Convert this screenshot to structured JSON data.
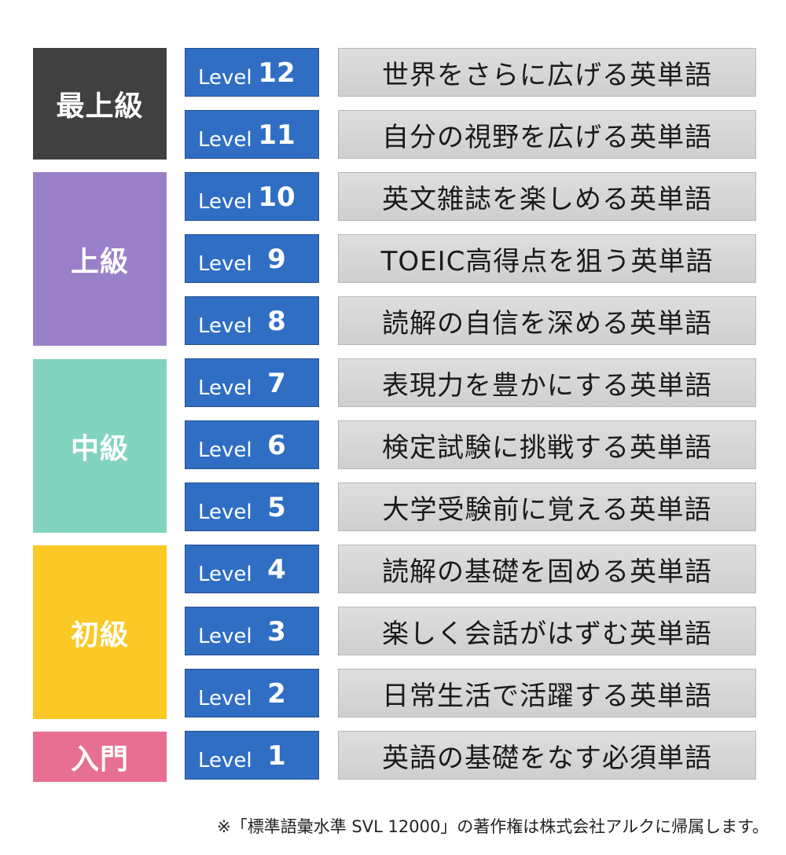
{
  "groups": [
    {
      "label": "最上級",
      "color": "#404040"
    },
    {
      "label": "上級",
      "color": "#9a80c9"
    },
    {
      "label": "中級",
      "color": "#82d4c0"
    },
    {
      "label": "初級",
      "color": "#fbc925"
    },
    {
      "label": "入門",
      "color": "#e76f92"
    }
  ],
  "levels": [
    {
      "word": "Level",
      "num": "12",
      "desc": "世界をさらに広げる英単語"
    },
    {
      "word": "Level",
      "num": "11",
      "desc": "自分の視野を広げる英単語"
    },
    {
      "word": "Level",
      "num": "10",
      "desc": "英文雑誌を楽しめる英単語"
    },
    {
      "word": "Level",
      "num": "9",
      "desc": "TOEIC高得点を狙う英単語"
    },
    {
      "word": "Level",
      "num": "8",
      "desc": "読解の自信を深める英単語"
    },
    {
      "word": "Level",
      "num": "7",
      "desc": "表現力を豊かにする英単語"
    },
    {
      "word": "Level",
      "num": "6",
      "desc": "検定試験に挑戦する英単語"
    },
    {
      "word": "Level",
      "num": "5",
      "desc": "大学受験前に覚える英単語"
    },
    {
      "word": "Level",
      "num": "4",
      "desc": "読解の基礎を固める英単語"
    },
    {
      "word": "Level",
      "num": "3",
      "desc": "楽しく会話がはずむ英単語"
    },
    {
      "word": "Level",
      "num": "2",
      "desc": "日常生活で活躍する英単語"
    },
    {
      "word": "Level",
      "num": "1",
      "desc": "英語の基礎をなす必須単語"
    }
  ],
  "footnote": "※「標準語彙水準 SVL 12000」の著作権は株式会社アルクに帰属します。",
  "colors": {
    "level_bg": "#2f6ec3",
    "desc_bg": "#d6d6d6"
  }
}
